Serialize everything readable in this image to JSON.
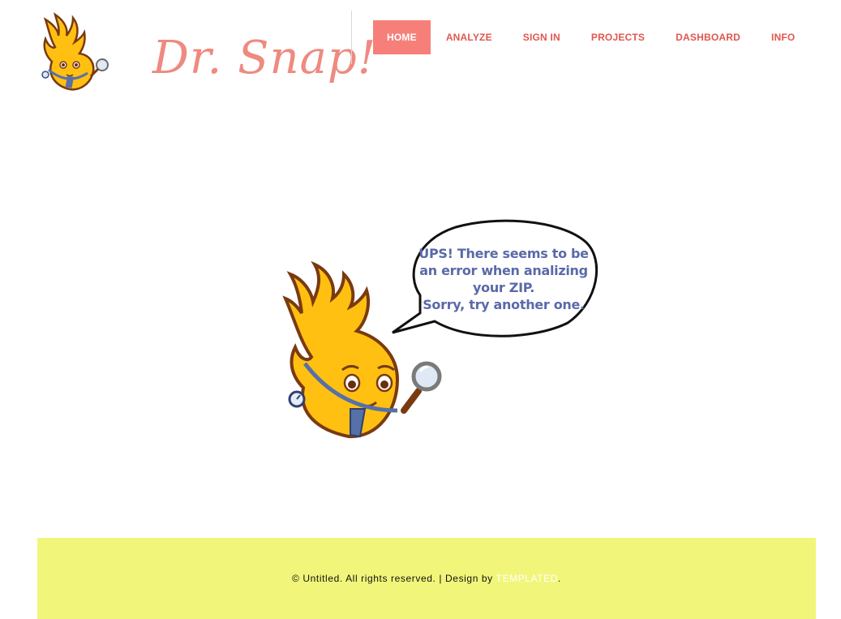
{
  "brand": {
    "logo_text": "Dr. Snap!",
    "color": "#ee8a80"
  },
  "nav": {
    "items": [
      {
        "label": "HOME",
        "active": true
      },
      {
        "label": "ANALYZE",
        "active": false
      },
      {
        "label": "SIGN IN",
        "active": false
      },
      {
        "label": "PROJECTS",
        "active": false
      },
      {
        "label": "DASHBOARD",
        "active": false
      },
      {
        "label": "INFO",
        "active": false
      }
    ],
    "active_bg": "#f77f7a",
    "link_color": "#e0574e"
  },
  "error": {
    "lines": [
      "UPS! There seems to be",
      "an error when analizing",
      "your ZIP.",
      "Sorry, try another one."
    ],
    "text_color": "#5a6aa8"
  },
  "mascot": {
    "icons": [
      "flame-mascot",
      "magnifying-glass-icon",
      "stopwatch-icon",
      "speech-bubble"
    ]
  },
  "footer": {
    "copyright": "© Untitled. All rights reserved. | Design by ",
    "link_label": "TEMPLATED",
    "suffix": ".",
    "bg": "#f1f67a"
  }
}
